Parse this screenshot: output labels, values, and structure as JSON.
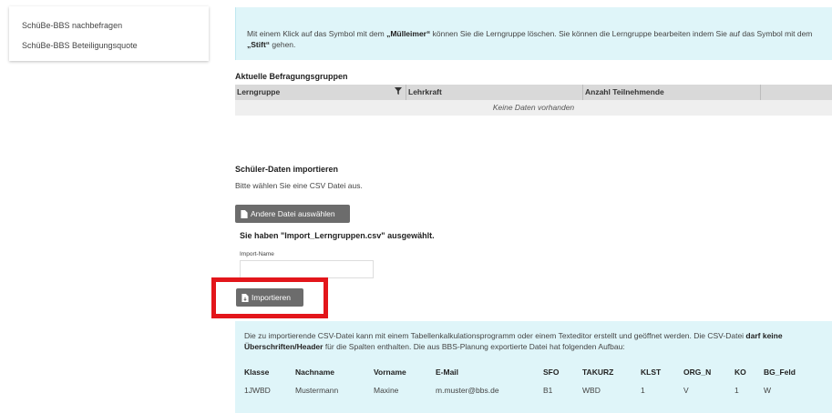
{
  "sidebar": {
    "items": [
      {
        "label": "SchüBe-BBS nachbefragen"
      },
      {
        "label": "SchüBe-BBS Beteiligungsquote"
      }
    ]
  },
  "info_top": {
    "pre": "Mit einem Klick auf das Symbol mit dem ",
    "bold1": "„Mülleimer“",
    "mid": " können Sie die Lerngruppe löschen. Sie können die Lerngruppe bearbeiten indem Sie auf das Symbol mit dem ",
    "bold2": "„Stift“",
    "post": " gehen."
  },
  "groups": {
    "title": "Aktuelle Befragungsgruppen",
    "columns": [
      "Lerngruppe",
      "Lehrkraft",
      "Anzahl Teilnehmende"
    ],
    "empty": "Keine Daten vorhanden"
  },
  "import": {
    "title": "Schüler-Daten importieren",
    "subtitle": "Bitte wählen Sie eine CSV Datei aus.",
    "change_file_label": "Andere Datei auswählen",
    "selected_text": "Sie haben \"Import_Lerngruppen.csv\" ausgewählt.",
    "name_label": "Import-Name",
    "name_value": "",
    "import_button": "Importieren"
  },
  "info_bottom": {
    "pre": "Die zu importierende CSV-Datei kann mit einem Tabellenkalkulationsprogramm oder einem Texteditor erstellt und geöffnet werden. Die CSV-Datei ",
    "bold1": "darf keine Überschriften/Header",
    "post": " für die Spalten enthalten. Die aus BBS-Planung exportierte Datei hat folgenden Aufbau:",
    "columns": [
      "Klasse",
      "Nachname",
      "Vorname",
      "E-Mail",
      "SFO",
      "TAKURZ",
      "KLST",
      "ORG_N",
      "KO",
      "BG_Feld"
    ],
    "rows": [
      [
        "1JWBD",
        "Mustermann",
        "Maxine",
        "m.muster@bbs.de",
        "B1",
        "WBD",
        "1",
        "V",
        "1",
        "W"
      ]
    ]
  }
}
